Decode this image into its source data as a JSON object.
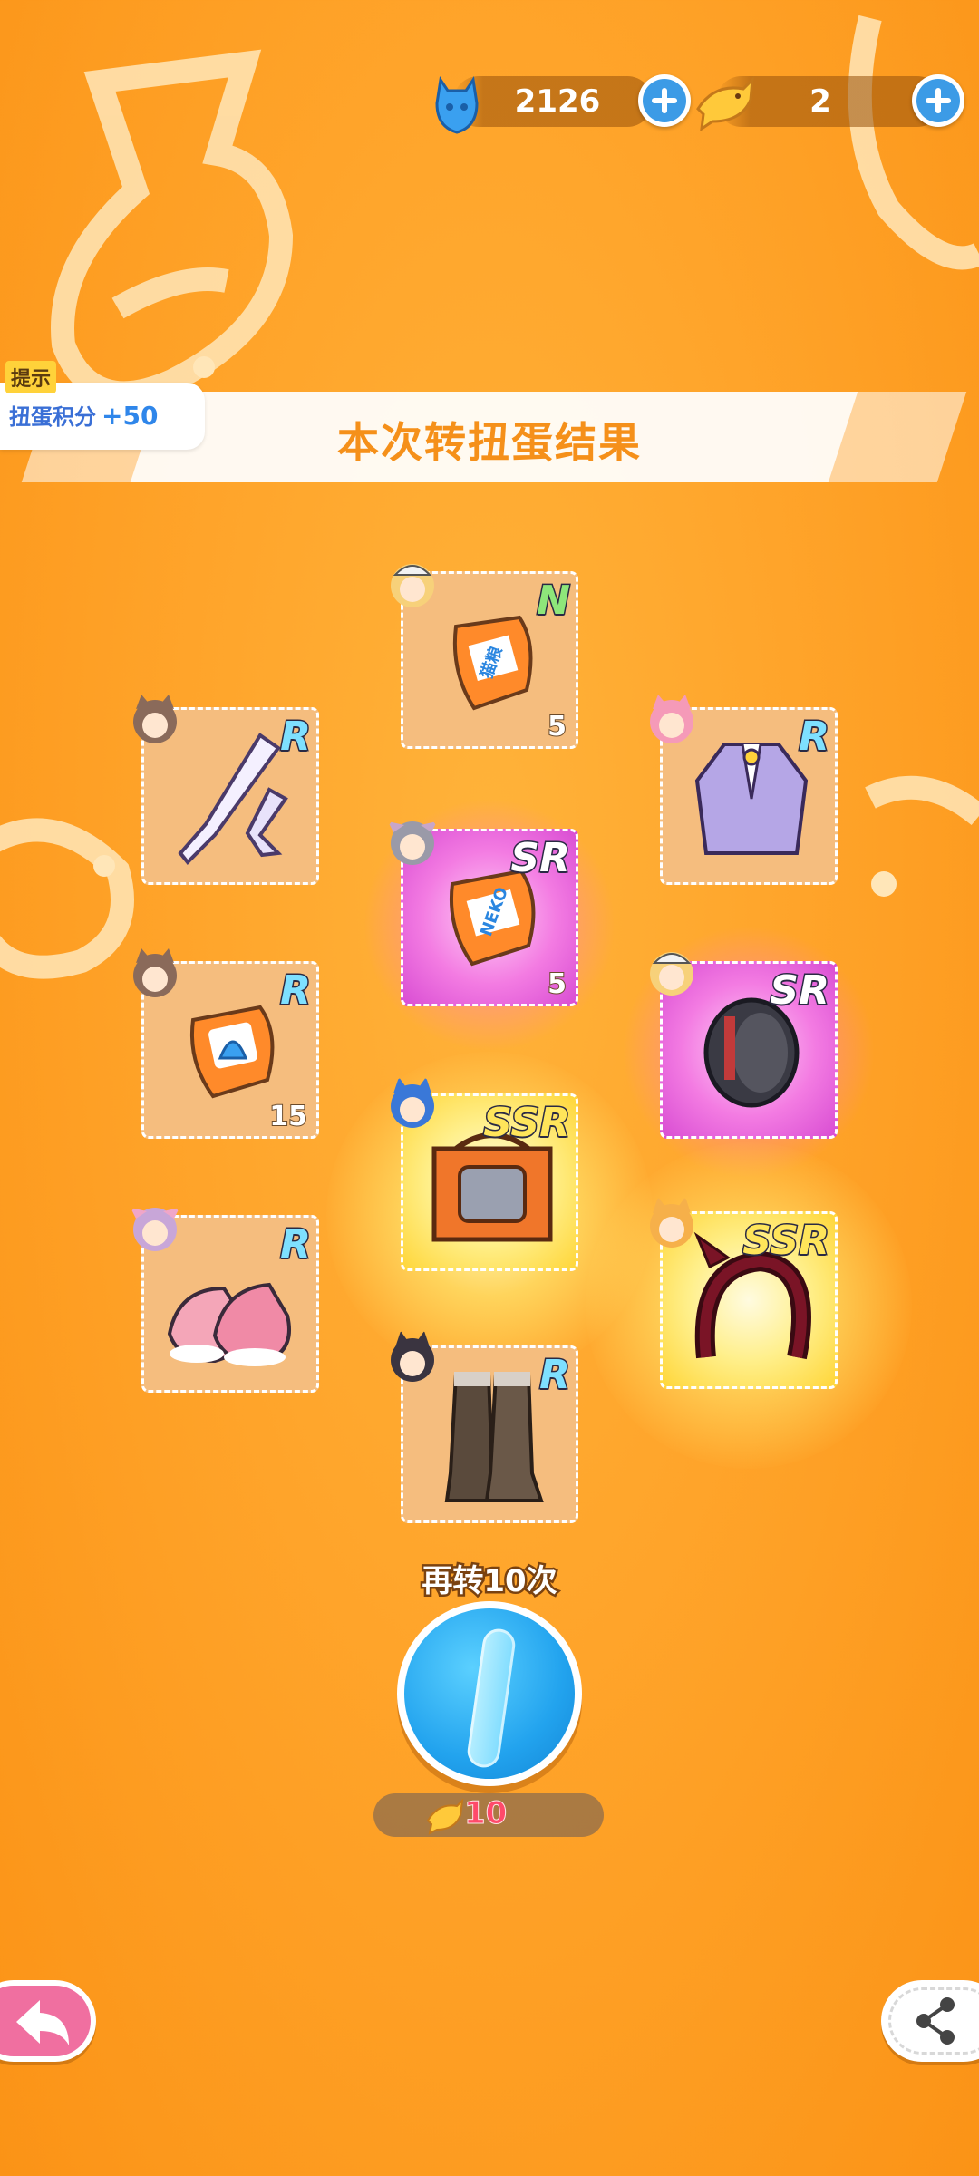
{
  "currency": {
    "gems": "2126",
    "gem_icon": "blue-cat-gem-icon",
    "fish": "2",
    "fish_icon": "golden-fish-icon"
  },
  "hint": {
    "tag": "提示",
    "label": "扭蛋积分",
    "value": "+50"
  },
  "banner": {
    "title": "本次转扭蛋结果"
  },
  "results": [
    {
      "rarity": "N",
      "item": "cat-food-bag-icon",
      "qty": "5",
      "avatar": "cap-girl-avatar"
    },
    {
      "rarity": "R",
      "item": "white-stockings-icon",
      "qty": "",
      "avatar": "brown-hair-girl-avatar"
    },
    {
      "rarity": "R",
      "item": "purple-vest-icon",
      "qty": "",
      "avatar": "pink-hair-girl-avatar"
    },
    {
      "rarity": "SR",
      "item": "nekko-food-bag-icon",
      "qty": "5",
      "avatar": "grey-hair-girl-avatar"
    },
    {
      "rarity": "R",
      "item": "bell-food-bag-icon",
      "qty": "15",
      "avatar": "brown-hair-girl-avatar"
    },
    {
      "rarity": "SR",
      "item": "black-bracelet-icon",
      "qty": "",
      "avatar": "blonde-cap-girl-avatar"
    },
    {
      "rarity": "SSR",
      "item": "cat-crate-icon",
      "qty": "",
      "avatar": "blue-hair-girl-avatar"
    },
    {
      "rarity": "R",
      "item": "pink-sneakers-icon",
      "qty": "",
      "avatar": "lilac-hair-girl-avatar"
    },
    {
      "rarity": "SSR",
      "item": "devil-horns-headband-icon",
      "qty": "",
      "avatar": "orange-hair-girl-avatar"
    },
    {
      "rarity": "R",
      "item": "brown-boots-icon",
      "qty": "",
      "avatar": "black-hair-girl-avatar"
    }
  ],
  "actions": {
    "again_label": "再转10次",
    "cost": "10",
    "cost_icon": "golden-fish-icon",
    "back_icon": "back-arrow-icon",
    "share_icon": "share-icon"
  },
  "colors": {
    "background": "#ffa42a",
    "banner_text": "#f5901a",
    "spin_button": "#22a3ee",
    "back_button": "#f06fa0",
    "cost_text": "#ff4a6a",
    "sr_card": "#f37be2",
    "ssr_card": "#ffe55a"
  }
}
